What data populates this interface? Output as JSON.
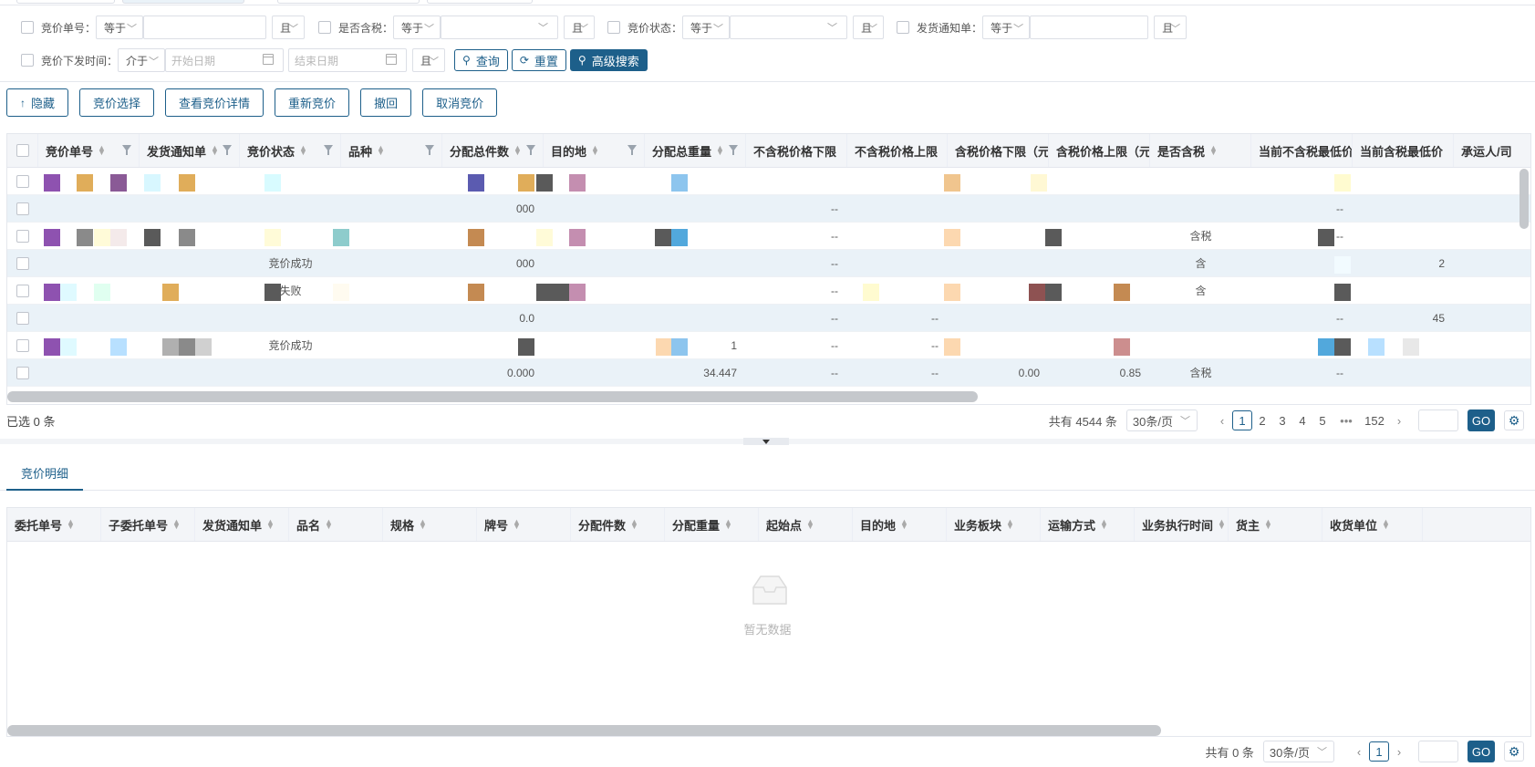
{
  "filters": {
    "row1": [
      {
        "label": "竞价单号：",
        "op": "等于",
        "conj": "且"
      },
      {
        "label": "是否含税：",
        "op": "等于",
        "conj": "且"
      },
      {
        "label": "竞价状态：",
        "op": "等于",
        "conj": "且"
      },
      {
        "label": "发货通知单：",
        "op": "等于",
        "conj": "且"
      }
    ],
    "row2": {
      "label": "竞价下发时间：",
      "op": "介于",
      "start_placeholder": "开始日期",
      "end_placeholder": "结束日期",
      "conj": "且"
    },
    "query_label": "查询",
    "reset_label": "重置",
    "advanced_label": "高级搜索"
  },
  "actions": [
    "隐藏",
    "竞价选择",
    "查看竞价详情",
    "重新竞价",
    "撤回",
    "取消竞价"
  ],
  "main_table": {
    "columns": [
      "竞价单号",
      "发货通知单",
      "竞价状态",
      "品种",
      "分配总件数",
      "目的地",
      "分配总重量",
      "不含税价格下限",
      "不含税价格上限",
      "含税价格下限（元",
      "含税价格上限（元",
      "是否含税",
      "当前不含税最低价",
      "当前含税最低价",
      "承运人/司"
    ],
    "rows": [
      {
        "status": "",
        "pieces": "",
        "weight": "",
        "ntl": "",
        "ntu": "",
        "tl": "",
        "tu": "",
        "tax": "",
        "cur_nt": "",
        "cur_t": ""
      },
      {
        "status": "",
        "pieces": "000",
        "weight": "",
        "ntl": "--",
        "ntu": "",
        "tl": "",
        "tu": "",
        "tax": "",
        "cur_nt": "--",
        "cur_t": ""
      },
      {
        "status": "",
        "pieces": "",
        "weight": "",
        "ntl": "--",
        "ntu": "",
        "tl": "",
        "tu": "",
        "tax": "含税",
        "cur_nt": "--",
        "cur_t": ""
      },
      {
        "status": "竞价成功",
        "pieces": "000",
        "weight": "",
        "ntl": "--",
        "ntu": "",
        "tl": "",
        "tu": "",
        "tax": "含",
        "cur_nt": "--",
        "cur_t": "2"
      },
      {
        "status": "失败",
        "pieces": "",
        "weight": "",
        "ntl": "--",
        "ntu": "",
        "tl": "",
        "tu": "",
        "tax": "含",
        "cur_nt": "--",
        "cur_t": ""
      },
      {
        "status": "",
        "pieces": "0.0",
        "weight": "",
        "ntl": "--",
        "ntu": "--",
        "tl": "",
        "tu": "",
        "tax": "",
        "cur_nt": "--",
        "cur_t": "45"
      },
      {
        "status": "竞价成功",
        "pieces": "0.0",
        "weight": "1",
        "ntl": "--",
        "ntu": "--",
        "tl": "",
        "tu": "",
        "tax": "",
        "cur_nt": "--",
        "cur_t": ""
      },
      {
        "status": "",
        "pieces": "0.000",
        "weight": "34.447",
        "ntl": "--",
        "ntu": "--",
        "tl": "0.00",
        "tu": "0.85",
        "tax": "含税",
        "cur_nt": "--",
        "cur_t": ""
      }
    ]
  },
  "selected_text": "已选 0 条",
  "pager_main": {
    "total": "共有 4544 条",
    "page_size": "30条/页",
    "pages": [
      "1",
      "2",
      "3",
      "4",
      "5",
      "•••",
      "152"
    ],
    "go": "GO"
  },
  "detail_tab": "竞价明细",
  "detail_table": {
    "columns": [
      "委托单号",
      "子委托单号",
      "发货通知单",
      "品名",
      "规格",
      "牌号",
      "分配件数",
      "分配重量",
      "起始点",
      "目的地",
      "业务板块",
      "运输方式",
      "业务执行时间",
      "货主",
      "收货单位"
    ],
    "empty_text": "暂无数据"
  },
  "pager_detail": {
    "total": "共有 0 条",
    "page_size": "30条/页",
    "page": "1",
    "go": "GO"
  },
  "colors": {
    "primary": "#1d5f8a",
    "header_bg": "#f3f5f8",
    "stripe": "#eaf2f8"
  }
}
